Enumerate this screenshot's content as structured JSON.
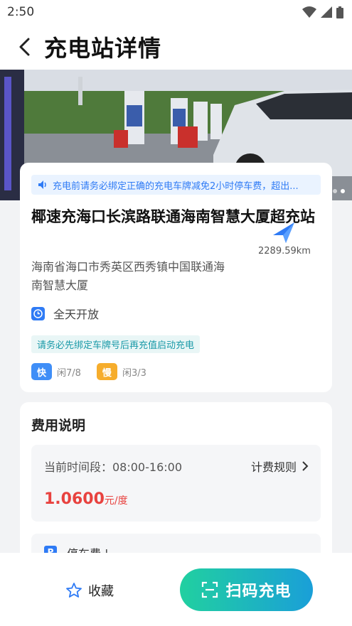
{
  "status_bar": {
    "time": "2:50"
  },
  "header": {
    "title": "充电站详情"
  },
  "hero": {
    "pages": 2,
    "active_page": 2
  },
  "station": {
    "notice": "充电前请务必绑定正确的充电车牌减免2小时停车费，超出...",
    "name": "椰速充海口长滨路联通海南智慧大厦超充站",
    "distance": "2289.59km",
    "address": "海南省海口市秀英区西秀镇中国联通海南智慧大厦",
    "hours": "全天开放",
    "tag": "请务必先绑定车牌号后再充值启动充电",
    "fast_label": "快",
    "fast_count": "闲7/8",
    "slow_label": "慢",
    "slow_count": "闲3/3"
  },
  "fee": {
    "title": "费用说明",
    "period": "当前时间段：08:00-16:00",
    "rule_label": "计费规则",
    "price": "1.0600",
    "unit": "元/度",
    "parking_icon": "P",
    "parking_label": "停车费 |"
  },
  "bottom": {
    "favorite": "收藏",
    "scan": "扫码充电"
  },
  "colors": {
    "accent": "#2f7bf5",
    "price": "#e8423f",
    "fast": "#3f8ef7",
    "slow": "#f6ad2c",
    "button_start": "#21d0a0",
    "button_end": "#1a9fd8"
  }
}
